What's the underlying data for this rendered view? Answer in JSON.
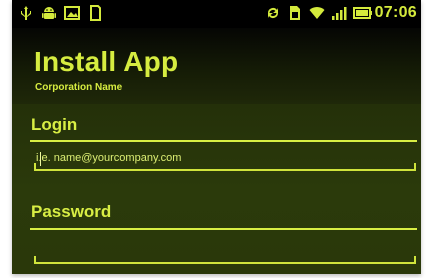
{
  "status_bar": {
    "left_icons": [
      "usb-icon",
      "android-icon",
      "image-icon",
      "sd-card-icon"
    ],
    "right_icons": [
      "sync-icon",
      "sim-icon",
      "wifi-icon",
      "signal-icon",
      "battery-icon"
    ],
    "time": "07:06"
  },
  "header": {
    "title": "Install App",
    "subtitle": "Corporation Name"
  },
  "form": {
    "login_label": "Login",
    "login_placeholder": "i.e. name@yourcompany.com",
    "password_label": "Password",
    "password_placeholder": ""
  },
  "colors": {
    "accent": "#d6ec40",
    "background": "#243009",
    "status_bar": "#000000"
  }
}
